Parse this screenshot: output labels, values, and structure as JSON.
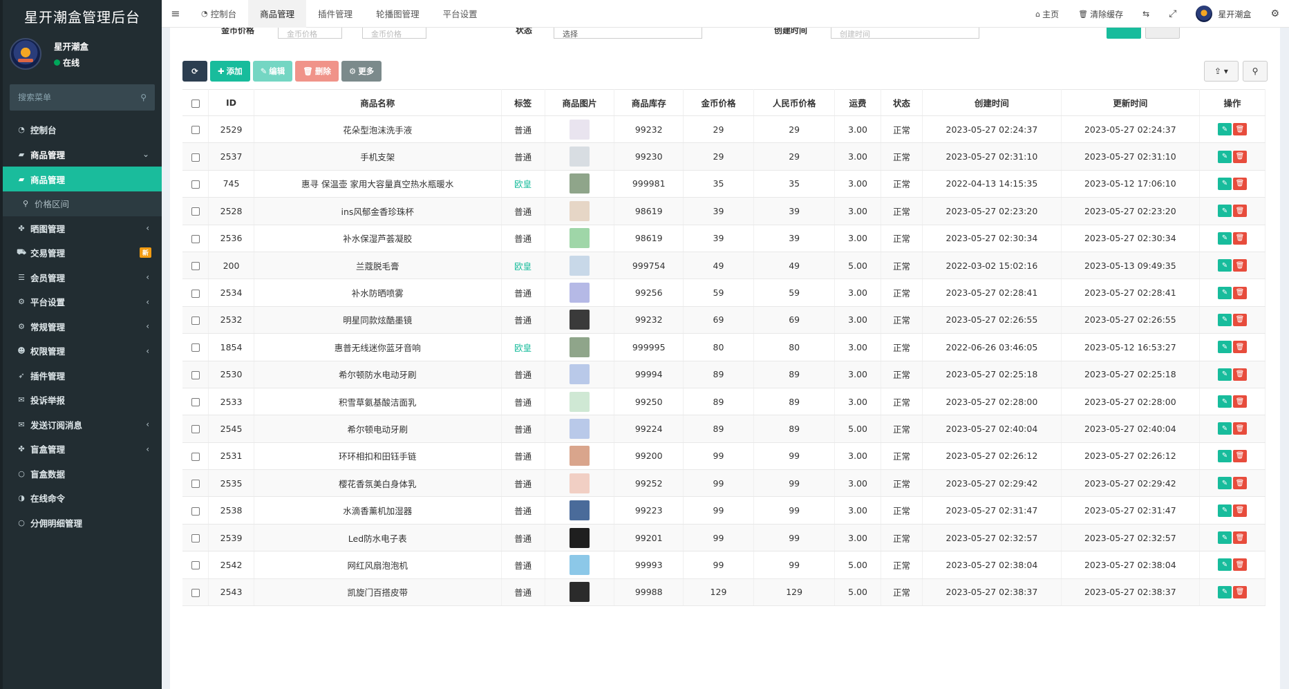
{
  "sidebar": {
    "logo": "星开潮盒管理后台",
    "user_name": "星开潮盒",
    "user_status": "在线",
    "search_placeholder": "搜索菜单",
    "items": [
      {
        "label": "控制台",
        "icon": "dashboard-icon",
        "glyph": "◔",
        "state": "normal",
        "arrow": ""
      },
      {
        "label": "商品管理",
        "icon": "bag-icon",
        "glyph": "▰",
        "state": "open",
        "arrow": "⌄"
      },
      {
        "label": "商品管理",
        "icon": "bag-icon",
        "glyph": "▰",
        "state": "active",
        "arrow": ""
      },
      {
        "label": "价格区间",
        "icon": "search-icon",
        "glyph": "⚲",
        "state": "sub",
        "arrow": ""
      },
      {
        "label": "晒图管理",
        "icon": "gift-icon",
        "glyph": "✤",
        "state": "normal",
        "arrow": "‹"
      },
      {
        "label": "交易管理",
        "icon": "cart-icon",
        "glyph": "⛟",
        "state": "normal",
        "arrow": "",
        "badge": "新"
      },
      {
        "label": "会员管理",
        "icon": "list-icon",
        "glyph": "☰",
        "state": "normal",
        "arrow": "‹"
      },
      {
        "label": "平台设置",
        "icon": "cogs-icon",
        "glyph": "⚙",
        "state": "normal",
        "arrow": "‹"
      },
      {
        "label": "常规管理",
        "icon": "cogs-icon",
        "glyph": "⚙",
        "state": "normal",
        "arrow": "‹"
      },
      {
        "label": "权限管理",
        "icon": "group-icon",
        "glyph": "☻",
        "state": "normal",
        "arrow": "‹"
      },
      {
        "label": "插件管理",
        "icon": "rocket-icon",
        "glyph": "➶",
        "state": "normal",
        "arrow": ""
      },
      {
        "label": "投诉举报",
        "icon": "envelope-icon",
        "glyph": "✉",
        "state": "normal",
        "arrow": ""
      },
      {
        "label": "发送订阅消息",
        "icon": "envelope-icon",
        "glyph": "✉",
        "state": "normal",
        "arrow": "‹"
      },
      {
        "label": "盲盒管理",
        "icon": "gift-icon",
        "glyph": "✤",
        "state": "normal",
        "arrow": "‹"
      },
      {
        "label": "盲盒数据",
        "icon": "circle-icon",
        "glyph": "○",
        "state": "normal",
        "arrow": ""
      },
      {
        "label": "在线命令",
        "icon": "adjust-icon",
        "glyph": "◑",
        "state": "normal",
        "arrow": ""
      },
      {
        "label": "分佣明细管理",
        "icon": "circle-icon",
        "glyph": "○",
        "state": "normal",
        "arrow": ""
      }
    ]
  },
  "topnav": {
    "tabs": [
      {
        "label": "控制台",
        "icon": "dashboard-icon",
        "glyph": "◔",
        "active": false
      },
      {
        "label": "商品管理",
        "icon": "",
        "glyph": "",
        "active": true
      },
      {
        "label": "插件管理",
        "icon": "",
        "glyph": "",
        "active": false
      },
      {
        "label": "轮播图管理",
        "icon": "",
        "glyph": "",
        "active": false
      },
      {
        "label": "平台设置",
        "icon": "",
        "glyph": "",
        "active": false
      }
    ],
    "home": "主页",
    "clear_cache": "清除缓存",
    "user": "星开潮盒"
  },
  "filters": {
    "gold_label": "金币价格",
    "gold_min_placeholder": "金币价格",
    "gold_max_placeholder": "金币价格",
    "status_label": "状态",
    "status_value": "选择",
    "created_label": "创建时间",
    "created_placeholder": "创建时间"
  },
  "toolbar": {
    "add": "添加",
    "edit": "编辑",
    "delete": "删除",
    "more": "更多"
  },
  "table": {
    "headers": [
      "ID",
      "商品名称",
      "标签",
      "商品图片",
      "商品库存",
      "金币价格",
      "人民币价格",
      "运费",
      "状态",
      "创建时间",
      "更新时间",
      "操作"
    ],
    "rows": [
      {
        "id": "2529",
        "name": "花朵型泡沫洗手液",
        "tag": "普通",
        "stock": "99232",
        "gold": "29",
        "rmb": "29",
        "ship": "3.00",
        "status": "正常",
        "created": "2023-05-27 02:24:37",
        "updated": "2023-05-27 02:24:37",
        "thumb": "#e9e4ef"
      },
      {
        "id": "2537",
        "name": "手机支架",
        "tag": "普通",
        "stock": "99230",
        "gold": "29",
        "rmb": "29",
        "ship": "3.00",
        "status": "正常",
        "created": "2023-05-27 02:31:10",
        "updated": "2023-05-27 02:31:10",
        "thumb": "#d8dde2"
      },
      {
        "id": "745",
        "name": "惠寻 保温壶 家用大容量真空热水瓶暖水",
        "tag": "欧皇",
        "stock": "999981",
        "gold": "35",
        "rmb": "35",
        "ship": "3.00",
        "status": "正常",
        "created": "2022-04-13 14:15:35",
        "updated": "2023-05-12 17:06:10",
        "thumb": "#8fa58a"
      },
      {
        "id": "2528",
        "name": "ins风郁金香珍珠杯",
        "tag": "普通",
        "stock": "98619",
        "gold": "39",
        "rmb": "39",
        "ship": "3.00",
        "status": "正常",
        "created": "2023-05-27 02:23:20",
        "updated": "2023-05-27 02:23:20",
        "thumb": "#e6d6c6"
      },
      {
        "id": "2536",
        "name": "补水保湿芦荟凝胶",
        "tag": "普通",
        "stock": "98619",
        "gold": "39",
        "rmb": "39",
        "ship": "3.00",
        "status": "正常",
        "created": "2023-05-27 02:30:34",
        "updated": "2023-05-27 02:30:34",
        "thumb": "#9fd6a8"
      },
      {
        "id": "200",
        "name": "兰蔻脱毛膏",
        "tag": "欧皇",
        "stock": "999754",
        "gold": "49",
        "rmb": "49",
        "ship": "5.00",
        "status": "正常",
        "created": "2022-03-02 15:02:16",
        "updated": "2023-05-13 09:49:35",
        "thumb": "#c8d8e8"
      },
      {
        "id": "2534",
        "name": "补水防晒喷雾",
        "tag": "普通",
        "stock": "99256",
        "gold": "59",
        "rmb": "59",
        "ship": "3.00",
        "status": "正常",
        "created": "2023-05-27 02:28:41",
        "updated": "2023-05-27 02:28:41",
        "thumb": "#b5b9e6"
      },
      {
        "id": "2532",
        "name": "明星同款炫酷墨镜",
        "tag": "普通",
        "stock": "99232",
        "gold": "69",
        "rmb": "69",
        "ship": "3.00",
        "status": "正常",
        "created": "2023-05-27 02:26:55",
        "updated": "2023-05-27 02:26:55",
        "thumb": "#3a3a3a"
      },
      {
        "id": "1854",
        "name": "惠普无线迷你蓝牙音响",
        "tag": "欧皇",
        "stock": "999995",
        "gold": "80",
        "rmb": "80",
        "ship": "3.00",
        "status": "正常",
        "created": "2022-06-26 03:46:05",
        "updated": "2023-05-12 16:53:27",
        "thumb": "#8fa58a"
      },
      {
        "id": "2530",
        "name": "希尔顿防水电动牙刷",
        "tag": "普通",
        "stock": "99994",
        "gold": "89",
        "rmb": "89",
        "ship": "3.00",
        "status": "正常",
        "created": "2023-05-27 02:25:18",
        "updated": "2023-05-27 02:25:18",
        "thumb": "#b9c9e9"
      },
      {
        "id": "2533",
        "name": "积雪草氨基酸洁面乳",
        "tag": "普通",
        "stock": "99250",
        "gold": "89",
        "rmb": "89",
        "ship": "3.00",
        "status": "正常",
        "created": "2023-05-27 02:28:00",
        "updated": "2023-05-27 02:28:00",
        "thumb": "#cfe8d4"
      },
      {
        "id": "2545",
        "name": "希尔顿电动牙刷",
        "tag": "普通",
        "stock": "99224",
        "gold": "89",
        "rmb": "89",
        "ship": "5.00",
        "status": "正常",
        "created": "2023-05-27 02:40:04",
        "updated": "2023-05-27 02:40:04",
        "thumb": "#b9c9e9"
      },
      {
        "id": "2531",
        "name": "环环相扣和田钰手链",
        "tag": "普通",
        "stock": "99200",
        "gold": "99",
        "rmb": "99",
        "ship": "3.00",
        "status": "正常",
        "created": "2023-05-27 02:26:12",
        "updated": "2023-05-27 02:26:12",
        "thumb": "#d9a58c"
      },
      {
        "id": "2535",
        "name": "樱花香氛美白身体乳",
        "tag": "普通",
        "stock": "99252",
        "gold": "99",
        "rmb": "99",
        "ship": "3.00",
        "status": "正常",
        "created": "2023-05-27 02:29:42",
        "updated": "2023-05-27 02:29:42",
        "thumb": "#f1cfc4"
      },
      {
        "id": "2538",
        "name": "水滴香薰机加湿器",
        "tag": "普通",
        "stock": "99223",
        "gold": "99",
        "rmb": "99",
        "ship": "3.00",
        "status": "正常",
        "created": "2023-05-27 02:31:47",
        "updated": "2023-05-27 02:31:47",
        "thumb": "#4a6b9a"
      },
      {
        "id": "2539",
        "name": "Led防水电子表",
        "tag": "普通",
        "stock": "99201",
        "gold": "99",
        "rmb": "99",
        "ship": "3.00",
        "status": "正常",
        "created": "2023-05-27 02:32:57",
        "updated": "2023-05-27 02:32:57",
        "thumb": "#1f1f1f"
      },
      {
        "id": "2542",
        "name": "网红风扇泡泡机",
        "tag": "普通",
        "stock": "99993",
        "gold": "99",
        "rmb": "99",
        "ship": "5.00",
        "status": "正常",
        "created": "2023-05-27 02:38:04",
        "updated": "2023-05-27 02:38:04",
        "thumb": "#8cc8e8"
      },
      {
        "id": "2543",
        "name": "凯旋门百搭皮带",
        "tag": "普通",
        "stock": "99988",
        "gold": "129",
        "rmb": "129",
        "ship": "5.00",
        "status": "正常",
        "created": "2023-05-27 02:38:37",
        "updated": "2023-05-27 02:38:37",
        "thumb": "#2b2b2b"
      }
    ]
  },
  "colors": {
    "accent": "#18bc9c",
    "danger": "#e74c3c",
    "sidebar_bg": "#222d32",
    "tag_special": "#18bc9c"
  }
}
